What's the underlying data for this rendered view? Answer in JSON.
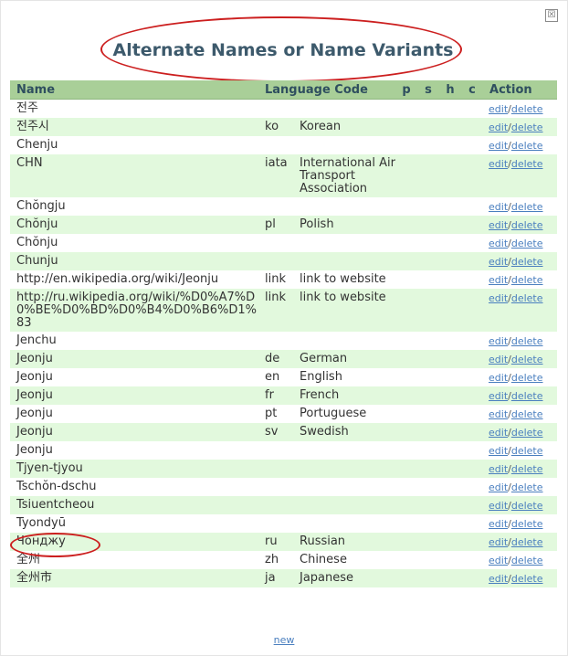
{
  "dialog": {
    "title": "Alternate Names or Name Variants",
    "close_label": "☒",
    "new_label": "new"
  },
  "table": {
    "headers": {
      "name": "Name",
      "language_code": "Language Code",
      "p": "p",
      "s": "s",
      "h": "h",
      "c": "c",
      "action": "Action"
    },
    "rows": [
      {
        "name": "전주",
        "code": "",
        "language": ""
      },
      {
        "name": "전주시",
        "code": "ko",
        "language": "Korean"
      },
      {
        "name": "Chenju",
        "code": "",
        "language": ""
      },
      {
        "name": "CHN",
        "code": "iata",
        "language": "International Air Transport Association"
      },
      {
        "name": "Chŏngju",
        "code": "",
        "language": ""
      },
      {
        "name": "Chŏnju",
        "code": "pl",
        "language": "Polish"
      },
      {
        "name": "Chŏnju",
        "code": "",
        "language": ""
      },
      {
        "name": "Chunju",
        "code": "",
        "language": ""
      },
      {
        "name": "http://en.wikipedia.org/wiki/Jeonju",
        "code": "link",
        "language": "link to website"
      },
      {
        "name": "http://ru.wikipedia.org/wiki/%D0%A7%D0%BE%D0%BD%D0%B4%D0%B6%D1%83",
        "code": "link",
        "language": "link to website"
      },
      {
        "name": "Jenchu",
        "code": "",
        "language": ""
      },
      {
        "name": "Jeonju",
        "code": "de",
        "language": "German"
      },
      {
        "name": "Jeonju",
        "code": "en",
        "language": "English"
      },
      {
        "name": "Jeonju",
        "code": "fr",
        "language": "French"
      },
      {
        "name": "Jeonju",
        "code": "pt",
        "language": "Portuguese"
      },
      {
        "name": "Jeonju",
        "code": "sv",
        "language": "Swedish"
      },
      {
        "name": "Jeonju",
        "code": "",
        "language": ""
      },
      {
        "name": "Tjyen-tjyou",
        "code": "",
        "language": ""
      },
      {
        "name": "Tschŏn-dschu",
        "code": "",
        "language": ""
      },
      {
        "name": "Tsiuentcheou",
        "code": "",
        "language": ""
      },
      {
        "name": "Tyondyū",
        "code": "",
        "language": ""
      },
      {
        "name": "Чонджу",
        "code": "ru",
        "language": "Russian"
      },
      {
        "name": "全州",
        "code": "zh",
        "language": "Chinese"
      },
      {
        "name": "全州市",
        "code": "ja",
        "language": "Japanese"
      }
    ],
    "edit_label": "edit",
    "separator": "/",
    "delete_label": "delete"
  },
  "colors": {
    "header_bg": "#a9cf98",
    "row_odd_bg": "#e2f9dd",
    "title": "#3d5a6c",
    "link": "#4a7fbf",
    "annotation": "#cc1f1f"
  }
}
